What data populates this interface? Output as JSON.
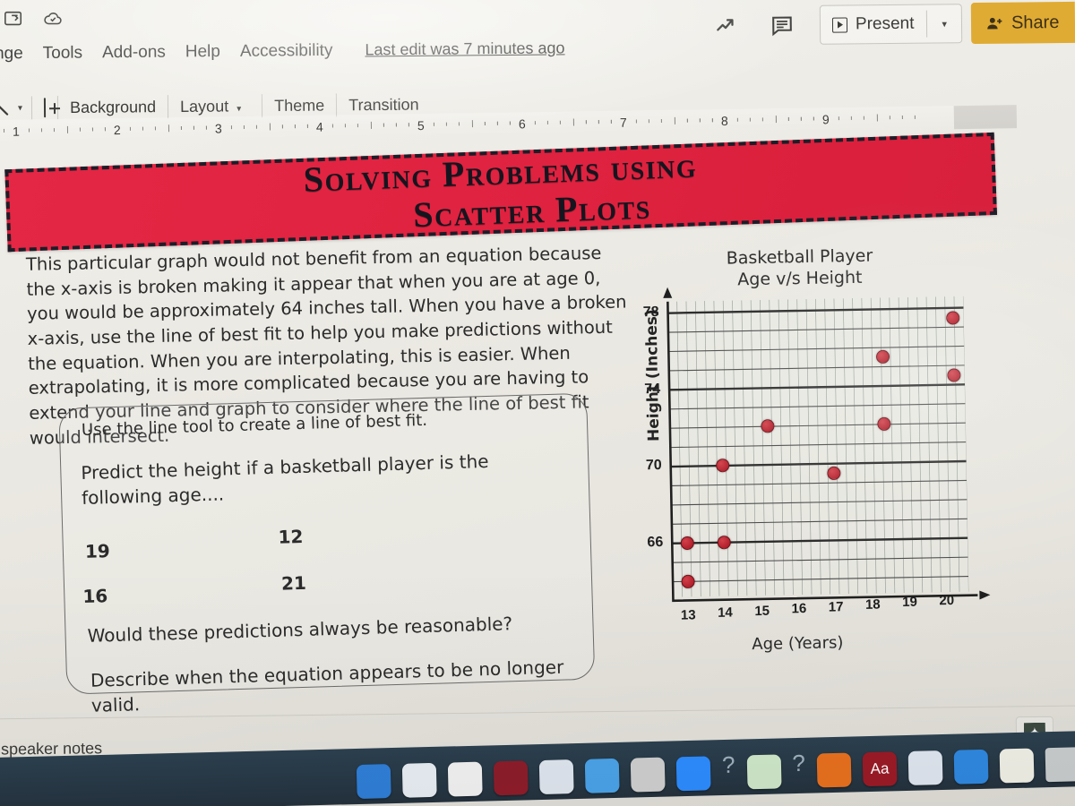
{
  "app": {
    "top_icons": [
      "present-remote-icon",
      "cloud-saved-icon"
    ],
    "menus": [
      "nge",
      "Tools",
      "Add-ons",
      "Help",
      "Accessibility"
    ],
    "last_edit": "Last edit was 7 minutes ago",
    "right_icons": [
      "trend-chart-icon",
      "speaker-notes-icon"
    ],
    "present_label": "Present",
    "present_caret": "▾",
    "share_label": "Share"
  },
  "toolbar": {
    "line_tool": "line-tool-icon",
    "caret": "▾",
    "new_slide": "new-slide-icon",
    "items": [
      "Background",
      "Layout",
      "Theme",
      "Transition"
    ],
    "layout_caret": "▾"
  },
  "ruler": {
    "numbers": [
      "1",
      "2",
      "3",
      "4",
      "5",
      "6",
      "7",
      "8",
      "9"
    ]
  },
  "slide": {
    "title_line1": "Solving Problems using",
    "title_line2": "Scatter Plots",
    "banner_color": "#e02340",
    "banner_border_color": "#1d1d28",
    "paragraph": "This particular graph would not benefit from an equation because the x-axis is broken making it appear that when you are at age 0, you would be approximately 64 inches tall.  When you have a broken x-axis, use the line of best fit to help you make predictions without the equation. When you are interpolating, this is easier. When extrapolating, it is more complicated because you are having to extend your line and graph to consider where the line of best fit would intersect.",
    "question_box": {
      "instruction": "Use the line tool to create a line of best fit.",
      "prompt": "Predict the height if a basketball player is the following age....",
      "ages_left": [
        "19",
        "16"
      ],
      "ages_right": [
        "12",
        "21"
      ],
      "question1": "Would these predictions always be reasonable?",
      "question2": "Describe when the equation appears to be no longer valid."
    }
  },
  "chart_data": {
    "type": "scatter",
    "title": "Basketball Player\nAge v/s Height",
    "title_line1": "Basketball Player",
    "title_line2": "Age v/s Height",
    "xlabel": "Age (Years)",
    "ylabel": "Height (Inches)",
    "xlim": [
      12.6,
      20.6
    ],
    "ylim": [
      63.2,
      78.6
    ],
    "xticks": [
      "13",
      "14",
      "15",
      "16",
      "17",
      "18",
      "19",
      "20"
    ],
    "xtick_values": [
      13,
      14,
      15,
      16,
      17,
      18,
      19,
      20
    ],
    "yticks": [
      "78",
      "74",
      "70",
      "66"
    ],
    "ytick_values": [
      78,
      74,
      70,
      66
    ],
    "grid": "major every 4 units on y and 1 unit on x, minor every 1 unit on y and 0.25 on x",
    "legend": "none",
    "point_color": "#b3202c",
    "points": [
      {
        "x": 13.0,
        "y": 66
      },
      {
        "x": 13.0,
        "y": 64
      },
      {
        "x": 14.0,
        "y": 66
      },
      {
        "x": 14.0,
        "y": 70
      },
      {
        "x": 15.25,
        "y": 72
      },
      {
        "x": 17.0,
        "y": 69.5
      },
      {
        "x": 18.4,
        "y": 72
      },
      {
        "x": 18.4,
        "y": 75.5
      },
      {
        "x": 20.3,
        "y": 74.5
      },
      {
        "x": 20.3,
        "y": 77.5
      }
    ]
  },
  "bottom": {
    "speaker_notes": "d speaker notes",
    "explore_icon": "explore-star-icon"
  },
  "dock": {
    "apps": [
      {
        "name": "finder-icon",
        "glyph": "",
        "color": "#2f7fd8"
      },
      {
        "name": "mail-icon",
        "glyph": "",
        "color": "#e8eef4"
      },
      {
        "name": "photos-icon",
        "glyph": "",
        "color": "#f2f2f2"
      },
      {
        "name": "book-icon",
        "glyph": "",
        "color": "#8e1d2a"
      },
      {
        "name": "notes-icon",
        "glyph": "",
        "color": "#dfe6ef"
      },
      {
        "name": "safari-icon",
        "glyph": "",
        "color": "#4aa3e8"
      },
      {
        "name": "koala-icon",
        "glyph": "",
        "color": "#cfcfcf"
      },
      {
        "name": "zoom-icon",
        "glyph": "",
        "color": "#2d8cff"
      },
      {
        "name": "question-icon",
        "glyph": "?",
        "color": "transparent"
      },
      {
        "name": "sims-icon",
        "glyph": "",
        "color": "#cfe8c8"
      },
      {
        "name": "question2-icon",
        "glyph": "?",
        "color": "transparent"
      },
      {
        "name": "firefox-icon",
        "glyph": "",
        "color": "#e8701f"
      },
      {
        "name": "adobe-icon",
        "glyph": "Aa",
        "color": "#9b1b26"
      },
      {
        "name": "preview-icon",
        "glyph": "",
        "color": "#dfe6ef"
      },
      {
        "name": "appstore-icon",
        "glyph": "",
        "color": "#2f88e0"
      },
      {
        "name": "stickies-icon",
        "glyph": "",
        "color": "#f0efe6"
      },
      {
        "name": "trash-icon",
        "glyph": "",
        "color": "#c8cccd"
      }
    ]
  }
}
